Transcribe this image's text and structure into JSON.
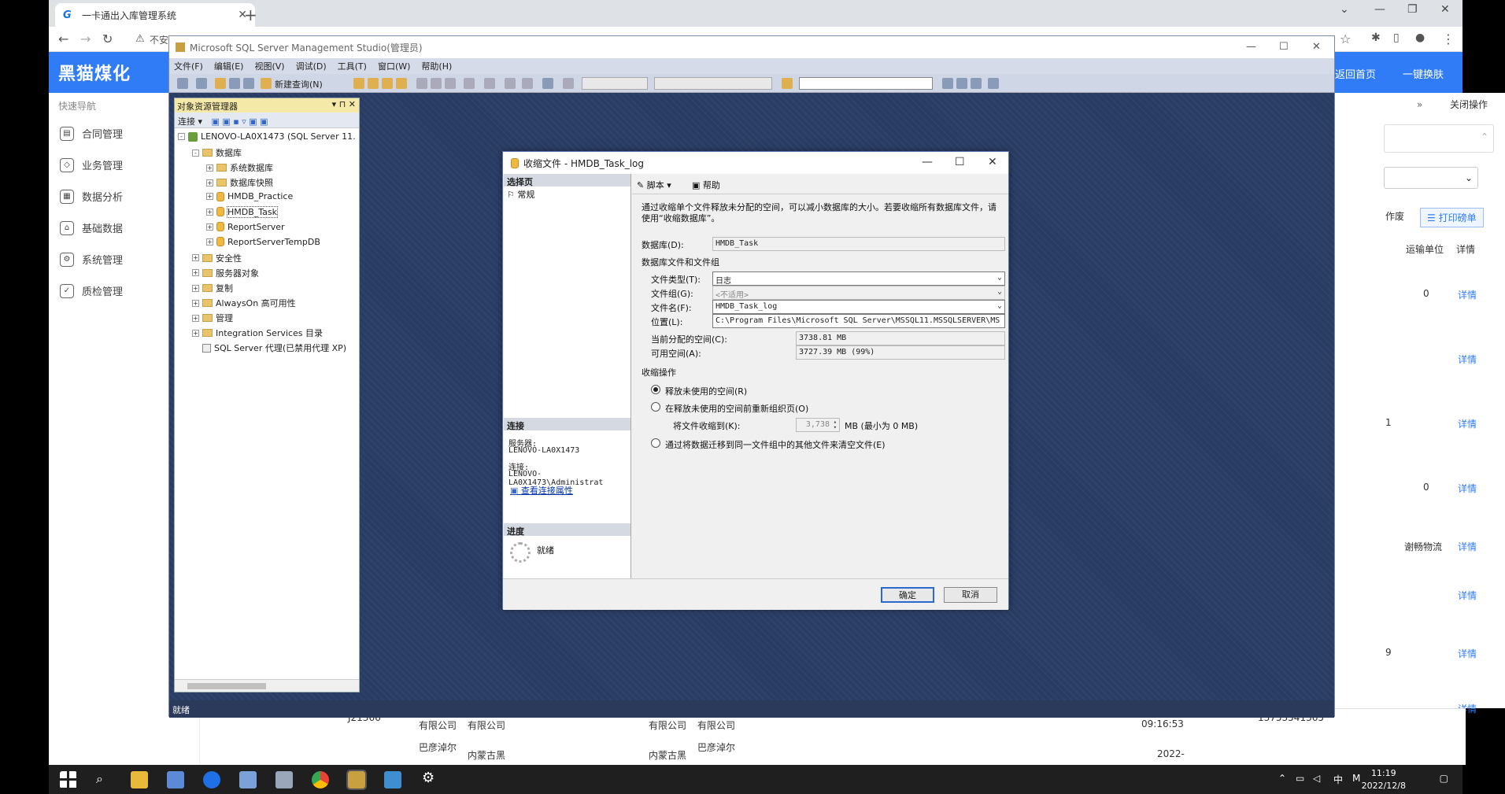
{
  "browser": {
    "tab_title": "一卡通出入库管理系统",
    "address_text": "不安",
    "header_logo": "黑猫煤化",
    "header_home": "返回首页",
    "header_skin": "一键换肤",
    "close_ops": "关闭操作",
    "quick_nav": "快速导航",
    "sidebar": [
      "合同管理",
      "业务管理",
      "数据分析",
      "基础数据",
      "系统管理",
      "质检管理"
    ],
    "right_panel": {
      "col_transport": "运输单位",
      "col_detail": "详情",
      "btn_print": "打印磅单",
      "btn_partial": "作废",
      "values": [
        "0",
        "",
        "1",
        "0",
        "谢畅物流",
        "",
        "9",
        ""
      ],
      "detail_link": "详情"
    },
    "bg_table": {
      "row1": [
        "有限公司",
        "有限公司",
        "有限公司",
        "有限公司",
        "09:16:53",
        "13753541365"
      ],
      "row2": [
        "巴彦淖尔",
        "内蒙古黑",
        "内蒙古黑",
        "巴彦淖尔",
        "2022-"
      ],
      "row0": [
        "J21366"
      ]
    }
  },
  "ssms": {
    "title": "Microsoft SQL Server Management Studio(管理员)",
    "menu": [
      "文件(F)",
      "编辑(E)",
      "视图(V)",
      "调试(D)",
      "工具(T)",
      "窗口(W)",
      "帮助(H)"
    ],
    "new_query": "新建查询(N)",
    "status": "就绪",
    "object_explorer": {
      "title": "对象资源管理器",
      "connect": "连接",
      "server": "LENOVO-LA0X1473 (SQL Server 11.",
      "nodes": [
        {
          "label": "数据库",
          "indent": 1,
          "pm": "-",
          "icon": "fold"
        },
        {
          "label": "系统数据库",
          "indent": 2,
          "pm": "+",
          "icon": "fold"
        },
        {
          "label": "数据库快照",
          "indent": 2,
          "pm": "+",
          "icon": "fold"
        },
        {
          "label": "HMDB_Practice",
          "indent": 2,
          "pm": "+",
          "icon": "db"
        },
        {
          "label": "HMDB_Task",
          "indent": 2,
          "pm": "+",
          "icon": "db"
        },
        {
          "label": "ReportServer",
          "indent": 2,
          "pm": "+",
          "icon": "db"
        },
        {
          "label": "ReportServerTempDB",
          "indent": 2,
          "pm": "+",
          "icon": "db"
        },
        {
          "label": "安全性",
          "indent": 1,
          "pm": "+",
          "icon": "fold"
        },
        {
          "label": "服务器对象",
          "indent": 1,
          "pm": "+",
          "icon": "fold"
        },
        {
          "label": "复制",
          "indent": 1,
          "pm": "+",
          "icon": "fold"
        },
        {
          "label": "AlwaysOn 高可用性",
          "indent": 1,
          "pm": "+",
          "icon": "fold"
        },
        {
          "label": "管理",
          "indent": 1,
          "pm": "+",
          "icon": "fold"
        },
        {
          "label": "Integration Services 目录",
          "indent": 1,
          "pm": "+",
          "icon": "fold"
        },
        {
          "label": "SQL Server 代理(已禁用代理 XP)",
          "indent": 1,
          "pm": "",
          "icon": "agent"
        }
      ]
    }
  },
  "dialog": {
    "title": "收缩文件 - HMDB_Task_log",
    "select_page": "选择页",
    "page_general": "常规",
    "script": "脚本",
    "help": "帮助",
    "description": "通过收缩单个文件释放未分配的空间，可以减小数据库的大小。若要收缩所有数据库文件，请使用“收缩数据库”。",
    "database_label": "数据库(D):",
    "database_value": "HMDB_Task",
    "files_group": "数据库文件和文件组",
    "file_type_label": "文件类型(T):",
    "file_type_value": "日志",
    "filegroup_label": "文件组(G):",
    "filegroup_value": "<不适用>",
    "filename_label": "文件名(F):",
    "filename_value": "HMDB_Task_log",
    "location_label": "位置(L):",
    "location_value": "C:\\Program Files\\Microsoft SQL Server\\MSSQL11.MSSQLSERVER\\MS",
    "allocated_label": "当前分配的空间(C):",
    "allocated_value": "3738.81 MB",
    "free_label": "可用空间(A):",
    "free_value": "3727.39 MB (99%)",
    "shrink_ops": "收缩操作",
    "opt1": "释放未使用的空间(R)",
    "opt2": "在释放未使用的空间前重新组织页(O)",
    "shrink_to_label": "将文件收缩到(K):",
    "shrink_to_value": "3,738",
    "shrink_to_unit": "MB (最小为 0 MB)",
    "opt3": "通过将数据迁移到同一文件组中的其他文件来清空文件(E)",
    "connection": "连接",
    "server_label": "服务器:",
    "server_value": "LENOVO-LA0X1473",
    "conn_label": "连接:",
    "conn_value": "LENOVO-LA0X1473\\Administrat",
    "view_conn": "查看连接属性",
    "progress": "进度",
    "ready": "就绪",
    "ok": "确定",
    "cancel": "取消"
  },
  "taskbar": {
    "time": "11:19",
    "date": "2022/12/8",
    "ime": "中",
    "ime2": "M"
  }
}
